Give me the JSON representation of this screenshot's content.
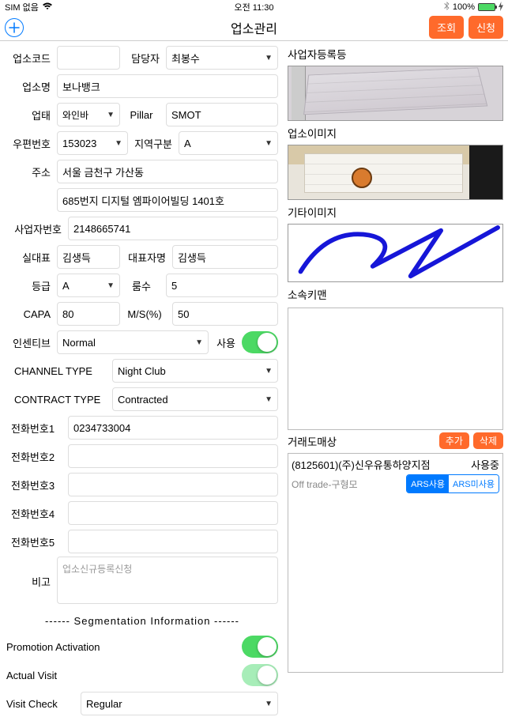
{
  "status": {
    "sim": "SIM 없음",
    "wifi_icon": "wifi",
    "time": "오전 11:30",
    "bt_icon": "bluetooth",
    "battery_pct": "100%",
    "charging": true
  },
  "nav": {
    "title": "업소관리",
    "query_btn": "조회",
    "apply_btn": "신청"
  },
  "form": {
    "code_lbl": "업소코드",
    "code_val": "",
    "manager_lbl": "담당자",
    "manager_val": "최봉수",
    "name_lbl": "업소명",
    "name_val": "보나뱅크",
    "biztype_lbl": "업태",
    "biztype_val": "와인바",
    "pillar_lbl": "Pillar",
    "pillar_val": "SMOT",
    "zip_lbl": "우편번호",
    "zip_val": "153023",
    "region_lbl": "지역구분",
    "region_val": "A",
    "addr_lbl": "주소",
    "addr1": "서울 금천구 가산동",
    "addr2": "685번지 디지털 엠파이어빌딩 1401호",
    "bizno_lbl": "사업자번호",
    "bizno_val": "2148665741",
    "owner_lbl": "실대표",
    "owner_val": "김생득",
    "repname_lbl": "대표자명",
    "repname_val": "김생득",
    "grade_lbl": "등급",
    "grade_val": "A",
    "rooms_lbl": "룸수",
    "rooms_val": "5",
    "capa_lbl": "CAPA",
    "capa_val": "80",
    "ms_lbl": "M/S(%)",
    "ms_val": "50",
    "incentive_lbl": "인센티브",
    "incentive_val": "Normal",
    "use_lbl": "사용",
    "channel_lbl": "CHANNEL TYPE",
    "channel_val": "Night Club",
    "contract_lbl": "CONTRACT TYPE",
    "contract_val": "Contracted",
    "tel1_lbl": "전화번호1",
    "tel1_val": "0234733004",
    "tel2_lbl": "전화번호2",
    "tel2_val": "",
    "tel3_lbl": "전화번호3",
    "tel3_val": "",
    "tel4_lbl": "전화번호4",
    "tel4_val": "",
    "tel5_lbl": "전화번호5",
    "tel5_val": "",
    "memo_lbl": "비고",
    "memo_placeholder": "업소신규등록신청",
    "seg_header": "------   Segmentation Information   ------",
    "promo_lbl": "Promotion Activation",
    "visit_lbl": "Actual Visit",
    "check_lbl": "Visit Check",
    "check_val": "Regular"
  },
  "right": {
    "bizreg_title": "사업자등록등",
    "shopimg_title": "업소이미지",
    "etcimg_title": "기타이미지",
    "keyman_title": "소속키맨",
    "trade_title": "거래도매상",
    "add_btn": "추가",
    "del_btn": "삭제",
    "trade_item": {
      "line1_left": "(8125601)(주)신우유통하양지점",
      "line1_right": "사용중",
      "line2_left": "Off trade-구형모",
      "ars_on": "ARS사용",
      "ars_off": "ARS미사용"
    }
  }
}
